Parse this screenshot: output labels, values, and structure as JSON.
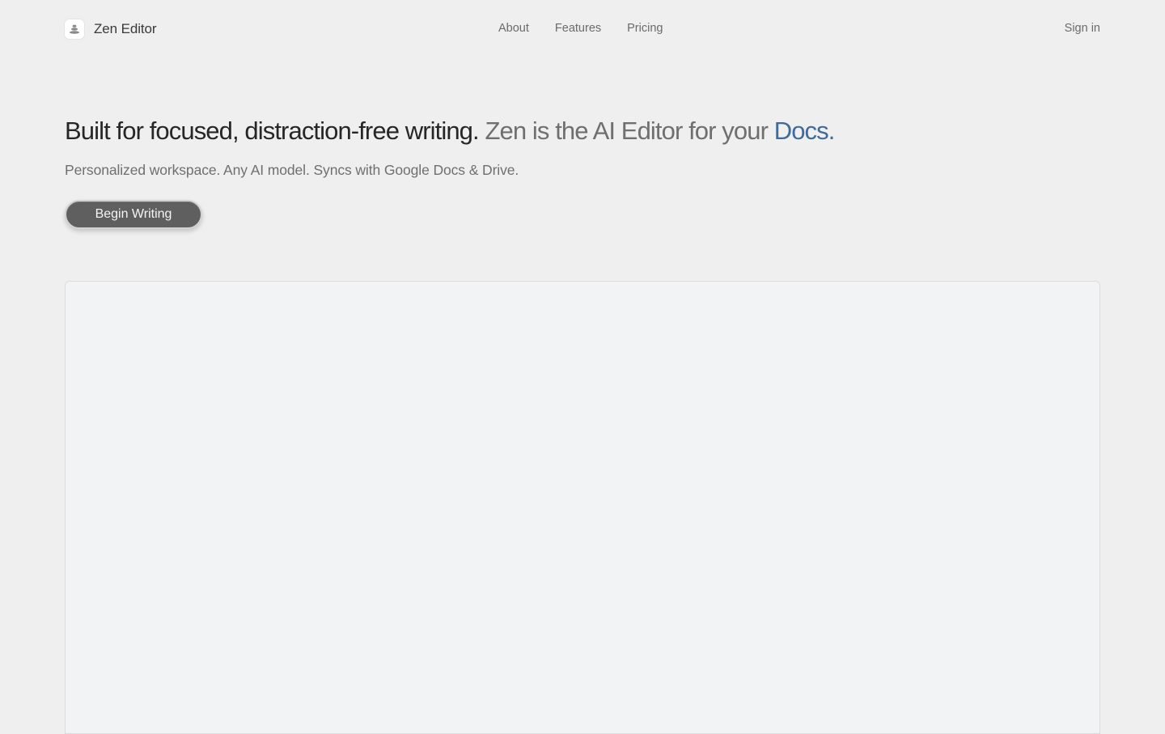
{
  "brand": {
    "name": "Zen Editor",
    "logo_icon": "stacked-stones-icon"
  },
  "nav": {
    "links": [
      "About",
      "Features",
      "Pricing"
    ],
    "signin": "Sign in"
  },
  "hero": {
    "headline_part1": "Built for focused, distraction-free writing.",
    "headline_part2": "Zen is the AI Editor for your",
    "headline_part3": "Docs.",
    "subheadline": "Personalized workspace. Any AI model. Syncs with Google Docs & Drive.",
    "cta_label": "Begin Writing"
  },
  "colors": {
    "background": "#efefef",
    "accent_blue": "#3f6b99",
    "button": "#5f5f5f"
  }
}
